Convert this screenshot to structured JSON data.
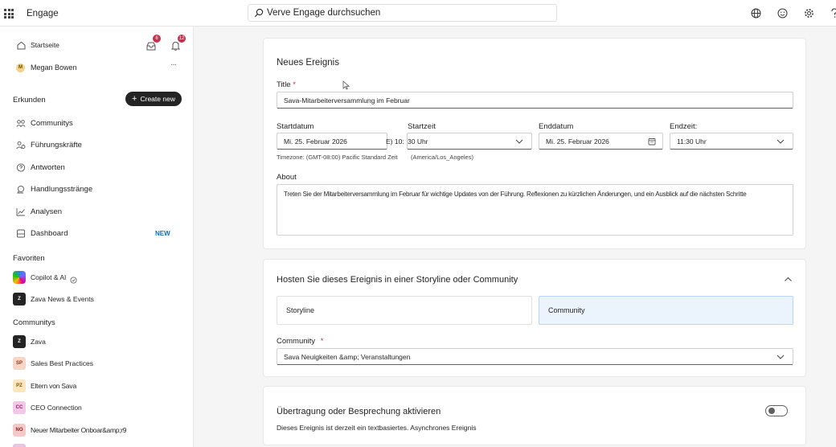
{
  "topbar": {
    "app_name": "Engage",
    "search_placeholder": "Verve Engage durchsuchen"
  },
  "sidebar": {
    "home": "Startseite",
    "notification_badges": [
      "6",
      "12"
    ],
    "user_initial": "M",
    "user_name": "Megan Bowen",
    "more": "···",
    "explore_heading": "Erkunden",
    "create_new": "Create new",
    "nav": [
      {
        "label": "Communitys",
        "icon": "communities-icon"
      },
      {
        "label": "Führungskräfte",
        "icon": "leaders-icon"
      },
      {
        "label": "Antworten",
        "icon": "answers-icon"
      },
      {
        "label": "Handlungsstränge",
        "icon": "storylines-icon"
      },
      {
        "label": "Analysen",
        "icon": "analytics-icon"
      },
      {
        "label": "Dashboard",
        "icon": "dashboard-icon",
        "tag": "NEW"
      }
    ],
    "favorites_heading": "Favoriten",
    "favorites": [
      {
        "label": "Copilot & AI",
        "tile": "",
        "color": "#7b61ff"
      },
      {
        "label": "Zava News & Events",
        "tile": "Z",
        "color": "#242424"
      }
    ],
    "communities_heading": "Communitys",
    "communities": [
      {
        "label": "Zava",
        "tile": "Z",
        "bg": "#242424",
        "fg": "#ffffff"
      },
      {
        "label": "Sales Best Practices",
        "tile": "SP",
        "bg": "#f6d6c6",
        "fg": "#8a3a1a"
      },
      {
        "label": "Eltern von Sava",
        "tile": "PZ",
        "bg": "#fbe6c0",
        "fg": "#7a5200"
      },
      {
        "label": "CEO Connection",
        "tile": "CC",
        "bg": "#f2c8e6",
        "fg": "#8a1a6a"
      },
      {
        "label": "Neuer Mitarbeiter Onboar&amp;r9",
        "tile": "NO",
        "bg": "#f5c9c9",
        "fg": "#8a1a1a"
      }
    ]
  },
  "event": {
    "heading": "Neues Ereignis",
    "title_label": "Title",
    "title_required": "*",
    "title_value": "Sava-Mitarbeiterversammlung im Februar",
    "start_date_label": "Startdatum",
    "start_date_value": "Mi. 25. Februar 2026",
    "start_time_label": "Startzeit",
    "start_time_overlap": "E) 10:",
    "start_time_value": "30 Uhr",
    "end_date_label": "Enddatum",
    "end_date_value": "Mi. 25. Februar 2026",
    "end_time_label": "Endzeit:",
    "end_time_value": "11:30 Uhr",
    "timezone_note": "Timezone: (GMT-08:00) Pacific Standard Zeit",
    "timezone_note_2": "(America/Los_Angeles)",
    "about_label": "About",
    "about_value": "Treten Sie der Mitarbeiterversammlung im Februar für wichtige Updates von der Führung. Reflexionen zu kürzlichen Änderungen, und ein Ausblick auf die nächsten Schritte"
  },
  "host": {
    "heading": "Hosten Sie dieses Ereignis in einer Storyline oder Community",
    "option_storyline": "Storyline",
    "option_community": "Community",
    "community_label": "Community",
    "community_required": "*",
    "community_value": "Sava Neuigkeiten &amp; Veranstaltungen"
  },
  "broadcast": {
    "heading": "Übertragung oder Besprechung aktivieren",
    "description": "Dieses Ereignis ist derzeit ein textbasiertes. Asynchrones Ereignis",
    "toggle_on": false
  },
  "colors": {
    "accent": "#0f6cbd",
    "selected_option_bg": "#ebf3fc",
    "selected_option_border": "#b4d6fa",
    "required": "#c4314b"
  }
}
